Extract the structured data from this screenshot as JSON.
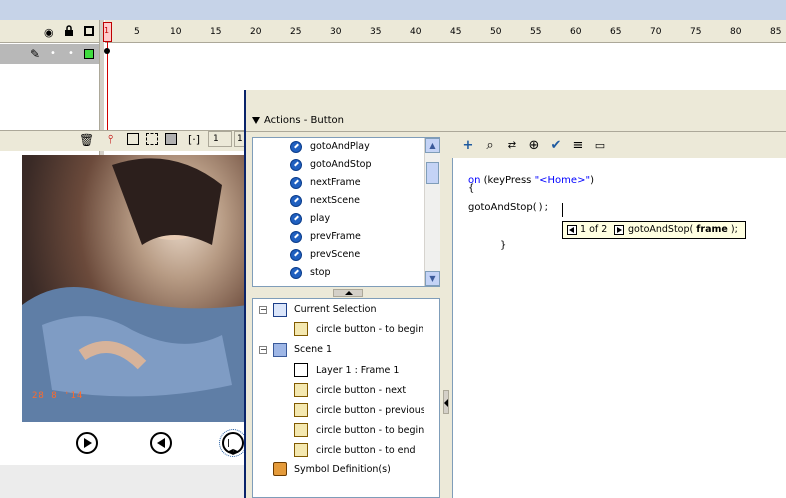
{
  "timeline": {
    "frame_numbers": [
      "1",
      "5",
      "10",
      "15",
      "20",
      "25",
      "30",
      "35",
      "40",
      "45",
      "50",
      "55",
      "60",
      "65",
      "70",
      "75",
      "80",
      "85"
    ],
    "current_frame": "1",
    "frame_field_extra": "1"
  },
  "actions_panel": {
    "title": "Actions - Button",
    "action_list": [
      "gotoAndPlay",
      "gotoAndStop",
      "nextFrame",
      "nextScene",
      "play",
      "prevFrame",
      "prevScene",
      "stop"
    ],
    "tree": {
      "current_selection_label": "Current Selection",
      "current_selection_item": "circle button - to beginning",
      "scene_label": "Scene 1",
      "scene_items": [
        "Layer 1 : Frame 1",
        "circle button - next",
        "circle button - previous",
        "circle button - to beginning",
        "circle button - to end"
      ],
      "symbol_definitions": "Symbol Definition(s)"
    },
    "script_lines": {
      "line1_kw": "on",
      "line1_open": " (keyPress ",
      "line1_str": "\"<Home>\"",
      "line1_close": ")",
      "line2": "{",
      "line3_a": "gotoAndStop",
      "line3_b": "();",
      "line4": "}"
    },
    "code_hint": {
      "counter": "1 of 2",
      "signature_prefix": "gotoAndStop(",
      "signature_param": "frame",
      "signature_suffix": ");"
    }
  },
  "photo": {
    "date_stamp": "28 8 '14"
  },
  "colors": {
    "title_bar": "#c6d3e8",
    "panel_bg": "#ece9d8",
    "keyword_blue": "#0000ff",
    "playhead_red": "#d00000",
    "tooltip_bg": "#ffffe1"
  },
  "icons": {
    "eye": "eye-icon",
    "lock": "lock-icon",
    "outline": "outline-icon",
    "pencil": "pencil-icon",
    "trash": "trash-icon",
    "add": "add-statement-icon",
    "find": "find-icon",
    "replace": "find-replace-icon",
    "target": "insert-target-path-icon",
    "check": "check-syntax-icon",
    "format": "auto-format-icon",
    "hint": "show-code-hint-icon"
  }
}
